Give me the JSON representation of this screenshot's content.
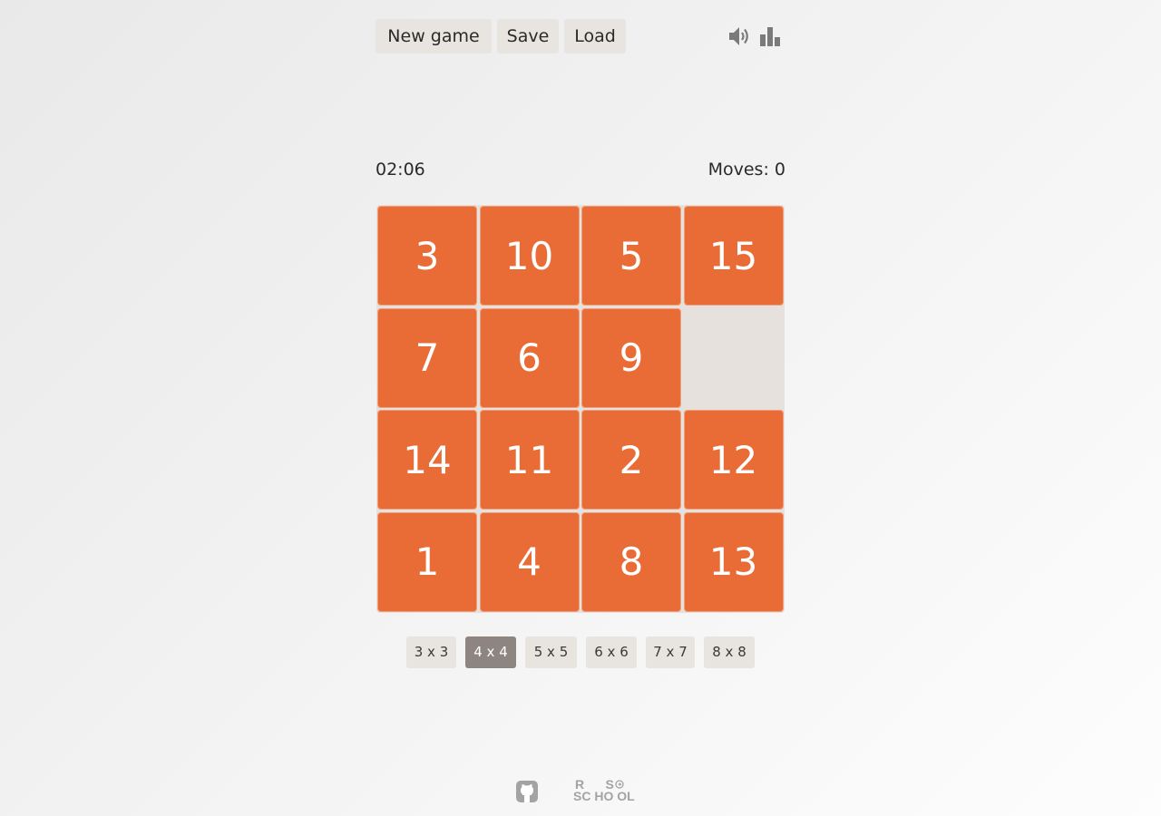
{
  "toolbar": {
    "new_game_label": "New game",
    "save_label": "Save",
    "load_label": "Load",
    "sound_icon": "speaker-icon",
    "stats_icon": "bar-chart-icon"
  },
  "status": {
    "timer": "02:06",
    "moves": "Moves: 0"
  },
  "board": {
    "size": 4,
    "tiles": [
      "3",
      "10",
      "5",
      "15",
      "7",
      "6",
      "9",
      "",
      "14",
      "11",
      "2",
      "12",
      "1",
      "4",
      "8",
      "13"
    ],
    "tile_color": "#e96c37",
    "empty_color": "#e6e1dc"
  },
  "sizes": {
    "options": [
      "3 x 3",
      "4 x 4",
      "5 x 5",
      "6 x 6",
      "7 x 7",
      "8 x 8"
    ],
    "selected": "4 x 4"
  },
  "footer": {
    "github_icon": "github-icon",
    "school_logo": "rs-school-logo",
    "school_logo_text": "RS SCHOOL"
  }
}
